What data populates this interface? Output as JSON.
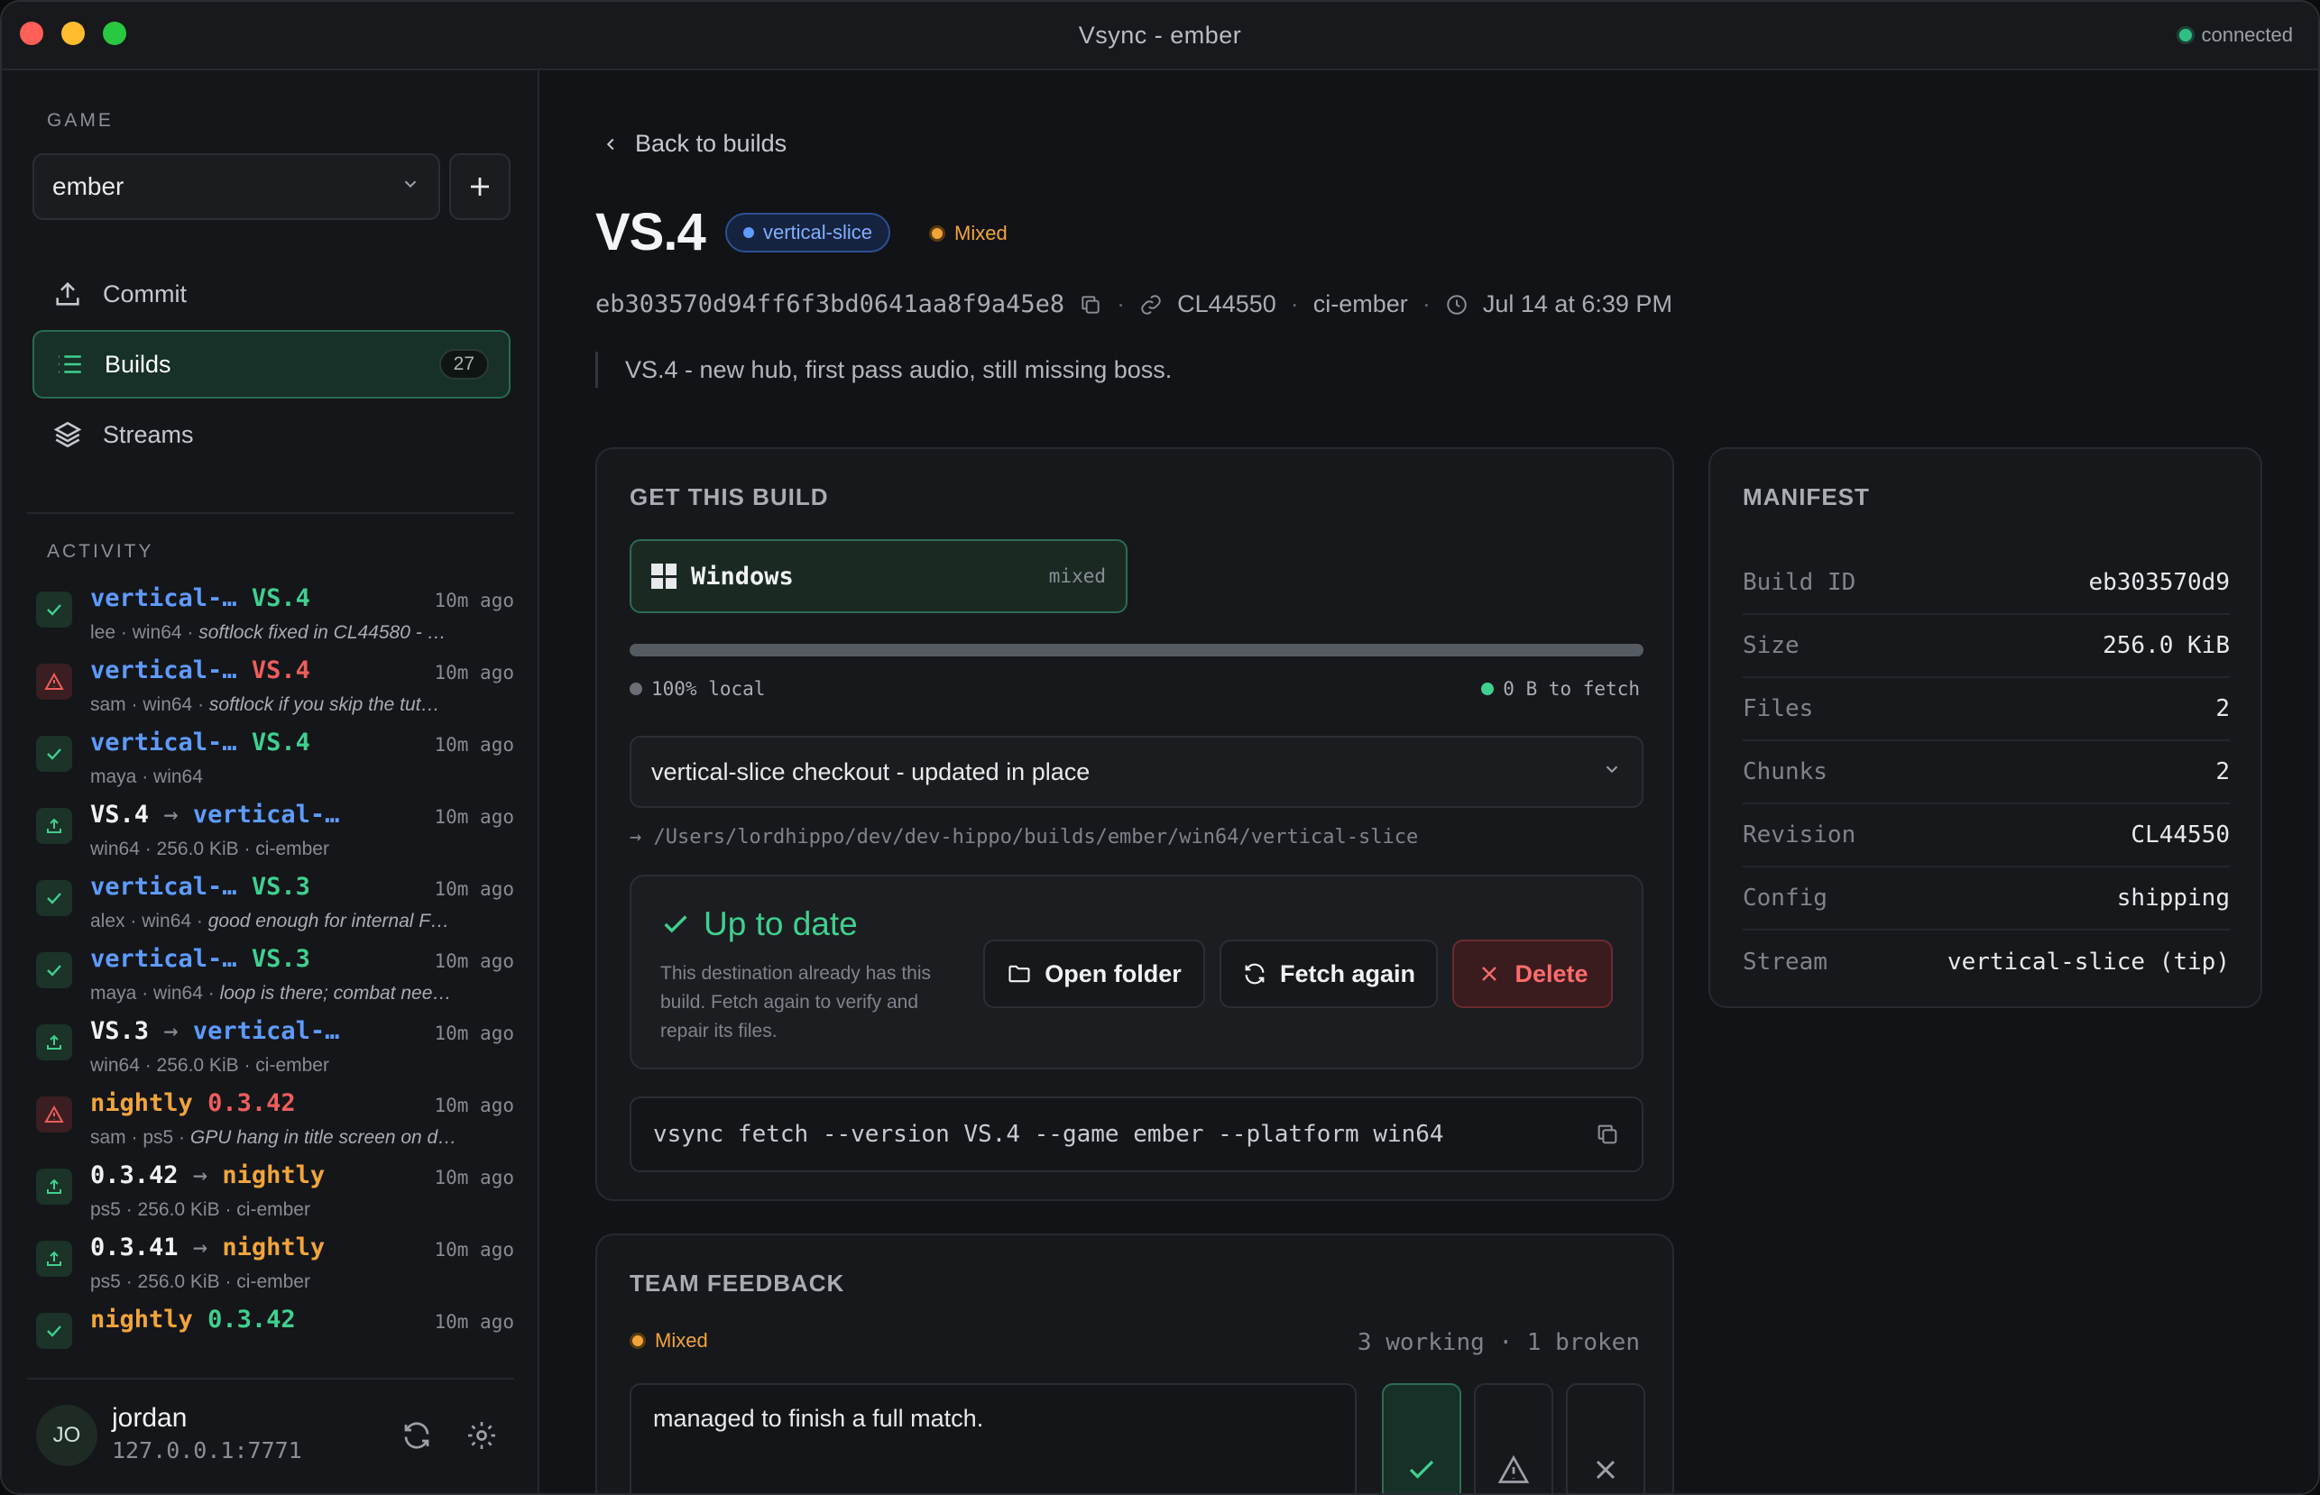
{
  "window": {
    "title": "Vsync - ember",
    "connection": "connected"
  },
  "sidebar": {
    "game_label": "GAME",
    "game_selected": "ember",
    "nav": [
      {
        "label": "Commit",
        "icon": "upload-icon"
      },
      {
        "label": "Builds",
        "icon": "list-icon",
        "count": "27",
        "active": true
      },
      {
        "label": "Streams",
        "icon": "layers-icon"
      }
    ],
    "activity_label": "ACTIVITY",
    "activity": [
      {
        "kind": "ok",
        "a": "vertical-…",
        "a_color": "blue",
        "arrow": "",
        "b": "VS.4",
        "b_color": "green",
        "time": "10m ago",
        "user": "lee",
        "platform": "win64",
        "note": "softlock fixed in CL44580 - …"
      },
      {
        "kind": "warn",
        "a": "vertical-…",
        "a_color": "blue",
        "arrow": "",
        "b": "VS.4",
        "b_color": "red",
        "time": "10m ago",
        "user": "sam",
        "platform": "win64",
        "note": "softlock if you skip the tut…"
      },
      {
        "kind": "ok",
        "a": "vertical-…",
        "a_color": "blue",
        "arrow": "",
        "b": "VS.4",
        "b_color": "green",
        "time": "10m ago",
        "user": "maya",
        "platform": "win64",
        "note": ""
      },
      {
        "kind": "up",
        "a": "VS.4",
        "a_color": "white",
        "arrow": "→",
        "b": "vertical-…",
        "b_color": "blue",
        "time": "10m ago",
        "user": "win64",
        "platform": "256.0 KiB",
        "note": "ci-ember",
        "plain": true
      },
      {
        "kind": "ok",
        "a": "vertical-…",
        "a_color": "blue",
        "arrow": "",
        "b": "VS.3",
        "b_color": "green",
        "time": "10m ago",
        "user": "alex",
        "platform": "win64",
        "note": "good enough for internal F…"
      },
      {
        "kind": "ok",
        "a": "vertical-…",
        "a_color": "blue",
        "arrow": "",
        "b": "VS.3",
        "b_color": "green",
        "time": "10m ago",
        "user": "maya",
        "platform": "win64",
        "note": "loop is there; combat nee…"
      },
      {
        "kind": "up",
        "a": "VS.3",
        "a_color": "white",
        "arrow": "→",
        "b": "vertical-…",
        "b_color": "blue",
        "time": "10m ago",
        "user": "win64",
        "platform": "256.0 KiB",
        "note": "ci-ember",
        "plain": true
      },
      {
        "kind": "warn",
        "a": "nightly",
        "a_color": "orange",
        "arrow": "",
        "b": "0.3.42",
        "b_color": "red",
        "time": "10m ago",
        "user": "sam",
        "platform": "ps5",
        "note": "GPU hang in title screen on d…"
      },
      {
        "kind": "up",
        "a": "0.3.42",
        "a_color": "white",
        "arrow": "→",
        "b": "nightly",
        "b_color": "orange",
        "time": "10m ago",
        "user": "ps5",
        "platform": "256.0 KiB",
        "note": "ci-ember",
        "plain": true
      },
      {
        "kind": "up",
        "a": "0.3.41",
        "a_color": "white",
        "arrow": "→",
        "b": "nightly",
        "b_color": "orange",
        "time": "10m ago",
        "user": "ps5",
        "platform": "256.0 KiB",
        "note": "ci-ember",
        "plain": true
      },
      {
        "kind": "ok",
        "a": "nightly",
        "a_color": "orange",
        "arrow": "",
        "b": "0.3.42",
        "b_color": "green",
        "time": "10m ago",
        "user": "",
        "platform": "",
        "note": ""
      }
    ],
    "user": {
      "initials": "JO",
      "name": "jordan",
      "address": "127.0.0.1:7771"
    }
  },
  "build": {
    "back_label": "Back to builds",
    "title": "VS.4",
    "stream": "vertical-slice",
    "status": "Mixed",
    "hash": "eb303570d94ff6f3bd0641aa8f9a45e8",
    "changelist": "CL44550",
    "author": "ci-ember",
    "date": "Jul 14 at 6:39 PM",
    "description": "VS.4 - new hub, first pass audio, still missing boss."
  },
  "get_build": {
    "label": "GET THIS BUILD",
    "platform": "Windows",
    "platform_tag": "mixed",
    "progress_fraction": 1.0,
    "local_label": "100% local",
    "fetch_label": "0 B to fetch",
    "destination": "vertical-slice checkout - updated in place",
    "path": "/Users/lordhippo/dev/dev-hippo/builds/ember/win64/vertical-slice",
    "status_title": "Up to date",
    "status_text": "This destination already has this build. Fetch again to verify and repair its files.",
    "open_folder": "Open folder",
    "fetch_again": "Fetch again",
    "delete": "Delete",
    "command": "vsync fetch --version VS.4 --game ember --platform win64"
  },
  "manifest": {
    "label": "MANIFEST",
    "rows": [
      {
        "k": "Build ID",
        "v": "eb303570d9"
      },
      {
        "k": "Size",
        "v": "256.0 KiB"
      },
      {
        "k": "Files",
        "v": "2"
      },
      {
        "k": "Chunks",
        "v": "2"
      },
      {
        "k": "Revision",
        "v": "CL44550"
      },
      {
        "k": "Config",
        "v": "shipping"
      },
      {
        "k": "Stream",
        "v": "vertical-slice (tip)"
      }
    ]
  },
  "feedback": {
    "label": "TEAM FEEDBACK",
    "status": "Mixed",
    "counts": "3 working · 1 broken",
    "text": "managed to finish a full match."
  },
  "colors": {
    "accent": "#3fd08f",
    "warn": "#f2a43a",
    "danger": "#ef5d5d",
    "stream": "#5e9bff"
  }
}
